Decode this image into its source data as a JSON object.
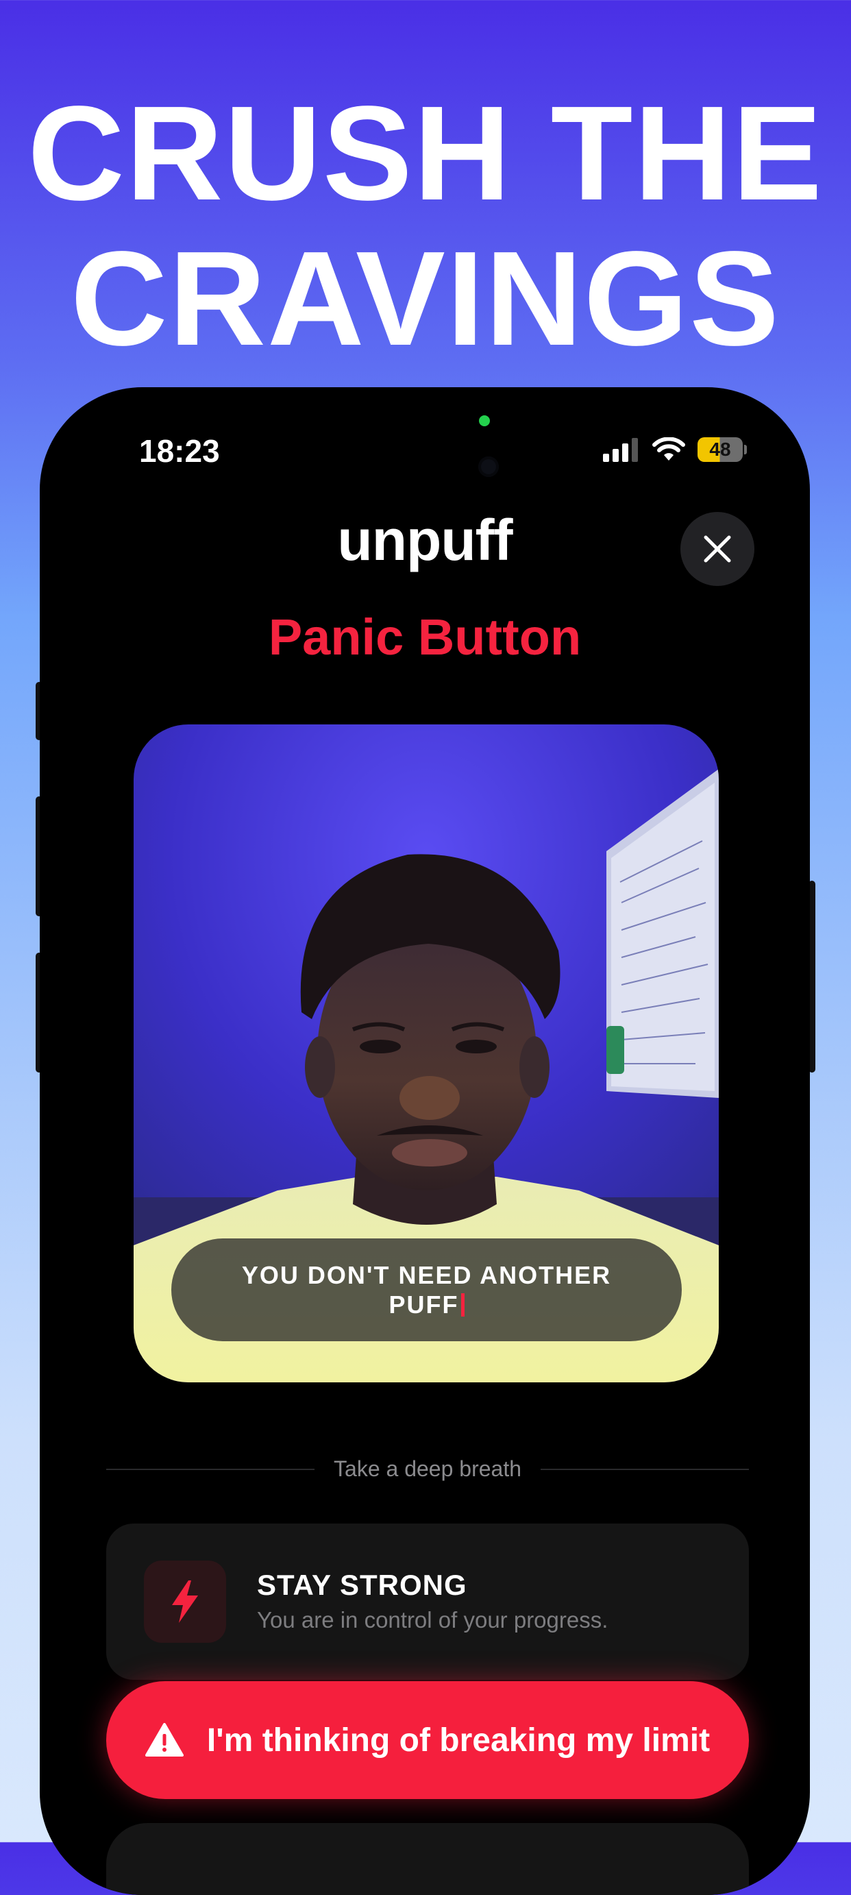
{
  "promo": {
    "headline_line1": "CRUSH THE",
    "headline_line2": "CRAVINGS"
  },
  "status_bar": {
    "time": "18:23",
    "battery": "48",
    "icons": [
      "signal-icon",
      "wifi-icon",
      "battery-icon"
    ]
  },
  "app": {
    "logo": "unpuff",
    "title": "Panic Button",
    "close_icon": "close-icon"
  },
  "camera": {
    "caption": "YOU DON'T NEED ANOTHER PUFF"
  },
  "divider": {
    "label": "Take a deep breath"
  },
  "tip": {
    "icon": "lightning-icon",
    "title": "STAY STRONG",
    "subtitle": "You are in control of your progress."
  },
  "panic_action": {
    "icon": "warning-icon",
    "label": "I'm thinking of breaking my limit"
  },
  "colors": {
    "accent_red": "#f5233f",
    "background_black": "#000000",
    "card_dark": "#151515",
    "gradient_top": "#4a2fe6",
    "gradient_bottom": "#d9e8fd"
  }
}
